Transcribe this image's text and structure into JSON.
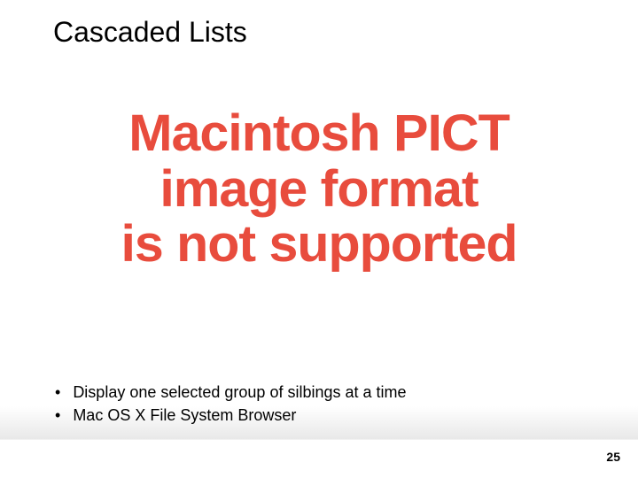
{
  "slide": {
    "title": "Cascaded Lists",
    "image_error": {
      "line1": "Macintosh PICT",
      "line2": "image format",
      "line3": "is not supported"
    },
    "bullets": [
      "Display one selected group of silbings at a time",
      "Mac OS X File System Browser"
    ],
    "page_number": "25"
  }
}
